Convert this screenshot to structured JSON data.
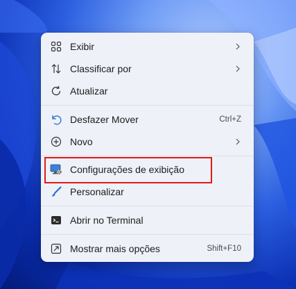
{
  "menu": {
    "items": [
      {
        "id": "view",
        "label": "Exibir",
        "icon": "grid-icon",
        "submenu": true
      },
      {
        "id": "sort",
        "label": "Classificar por",
        "icon": "sort-arrows-icon",
        "submenu": true
      },
      {
        "id": "refresh",
        "label": "Atualizar",
        "icon": "refresh-icon"
      },
      {
        "id": "undo",
        "label": "Desfazer Mover",
        "icon": "undo-icon",
        "shortcut": "Ctrl+Z"
      },
      {
        "id": "new",
        "label": "Novo",
        "icon": "plus-circle-icon",
        "submenu": true
      },
      {
        "id": "display",
        "label": "Configurações de exibição",
        "icon": "monitor-settings-icon"
      },
      {
        "id": "personalize",
        "label": "Personalizar",
        "icon": "brush-icon"
      },
      {
        "id": "terminal",
        "label": "Abrir no Terminal",
        "icon": "terminal-icon"
      },
      {
        "id": "more",
        "label": "Mostrar mais opções",
        "icon": "more-options-icon",
        "shortcut": "Shift+F10"
      }
    ]
  },
  "colors": {
    "accent": "#0063b1",
    "highlight_border": "#e01919",
    "menu_bg": "#eef1f7"
  }
}
